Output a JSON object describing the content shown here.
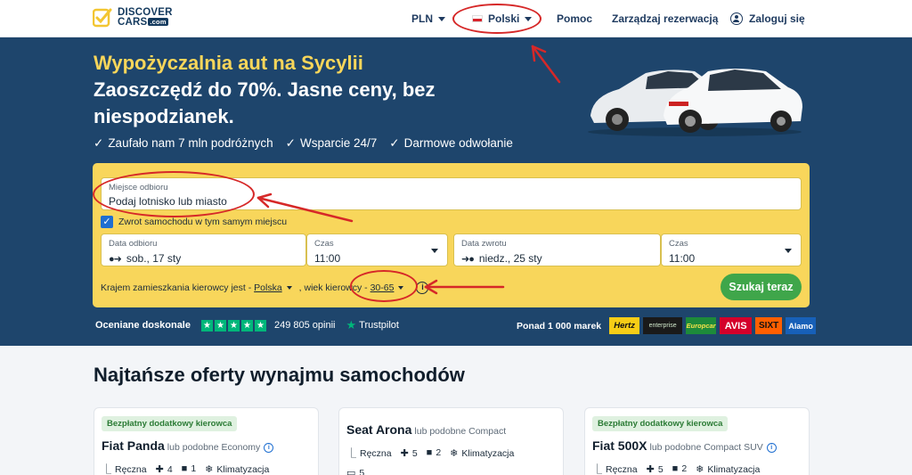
{
  "header": {
    "logo_line1": "DISCOVER",
    "logo_line2": "CARS",
    "logo_domain": ".com",
    "currency": "PLN",
    "language": "Polski",
    "help": "Pomoc",
    "manage": "Zarządzaj rezerwacją",
    "login": "Zaloguj się"
  },
  "hero": {
    "title": "Wypożyczalnia aut na Sycylii",
    "subtitle": "Zaoszczędź do 70%. Jasne ceny, bez niespodzianek.",
    "perks": [
      "Zaufało nam 7 mln podróżnych",
      "Wsparcie 24/7",
      "Darmowe odwołanie"
    ]
  },
  "search": {
    "pickup_label": "Miejsce odbioru",
    "pickup_placeholder": "Podaj lotnisko lub miasto",
    "same_location": "Zwrot samochodu w tym samym miejscu",
    "pickup_date_label": "Data odbioru",
    "pickup_date": "sob., 17 sty",
    "pickup_time_label": "Czas",
    "pickup_time": "11:00",
    "return_date_label": "Data zwrotu",
    "return_date": "niedz., 25 sty",
    "return_time_label": "Czas",
    "return_time": "11:00",
    "residency_text": "Krajem zamieszkania kierowcy jest -",
    "residency_value": "Polska",
    "age_text": ", wiek kierowcy -",
    "age_value": "30-65",
    "search_button": "Szukaj teraz"
  },
  "trust": {
    "label": "Oceniane doskonale",
    "reviews": "249 805 opinii",
    "provider": "Trustpilot",
    "rating_stars": 5
  },
  "brands": {
    "label": "Ponad 1 000 marek",
    "items": [
      "Hertz",
      "enterprise",
      "Europcar",
      "AVIS",
      "SIXT",
      "Alamo"
    ]
  },
  "offers": {
    "title": "Najtańsze oferty wynajmu samochodów",
    "cards": [
      {
        "badge": "Bezpłatny dodatkowy kierowca",
        "name": "Fiat Panda",
        "similar": "lub podobne Economy",
        "transmission": "Ręczna",
        "seats": "4",
        "bags": "1",
        "ac": "Klimatyzacja",
        "doors": ""
      },
      {
        "badge": "",
        "name": "Seat Arona",
        "similar": "lub podobne Compact",
        "transmission": "Ręczna",
        "seats": "5",
        "bags": "2",
        "ac": "Klimatyzacja",
        "doors": "5"
      },
      {
        "badge": "Bezpłatny dodatkowy kierowca",
        "name": "Fiat 500X",
        "similar": "lub podobne Compact SUV",
        "transmission": "Ręczna",
        "seats": "5",
        "bags": "2",
        "ac": "Klimatyzacja",
        "doors": ""
      }
    ]
  },
  "colors": {
    "hero_bg": "#1e456c",
    "accent_yellow": "#f8d65b",
    "cta_green": "#3fa64a",
    "annotation_red": "#d62828"
  }
}
